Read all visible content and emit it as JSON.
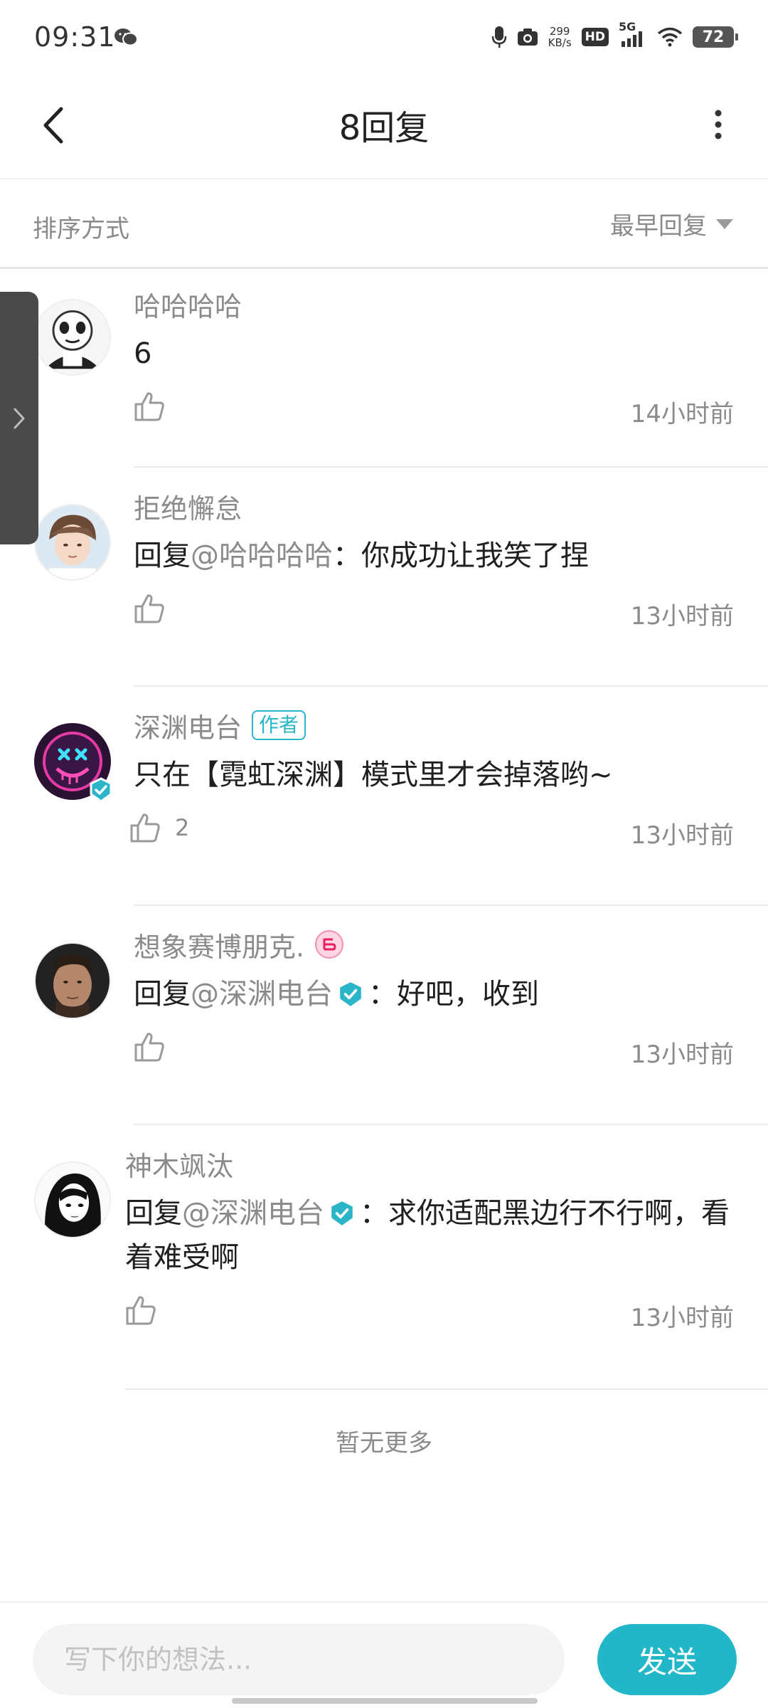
{
  "status_bar": {
    "time": "09:31",
    "net_speed_value": "299",
    "net_speed_unit": "KB/s",
    "hd_label": "HD",
    "network_label": "5G",
    "battery_level": "72"
  },
  "header": {
    "title": "8回复"
  },
  "sort_bar": {
    "label": "排序方式",
    "selected": "最早回复"
  },
  "comments": [
    {
      "name": "哈哈哈哈",
      "text": "6",
      "likes": "",
      "time": "14小时前"
    },
    {
      "name": "拒绝懈怠",
      "reply_prefix": "回复",
      "mention": "@哈哈哈哈",
      "text": "：你成功让我笑了捏",
      "likes": "",
      "time": "13小时前"
    },
    {
      "name": "深渊电台",
      "tag": "作者",
      "text": "只在【霓虹深渊】模式里才会掉落哟~",
      "likes": "2",
      "time": "13小时前"
    },
    {
      "name": "想象赛博朋克.",
      "reply_prefix": "回复",
      "mention": "@深渊电台",
      "text": "：好吧，收到",
      "likes": "",
      "time": "13小时前"
    },
    {
      "name": "神木飒汰",
      "reply_prefix": "回复",
      "mention": "@深渊电台",
      "text": "：求你适配黑边行不行啊，看着难受啊",
      "likes": "",
      "time": "13小时前"
    }
  ],
  "footer_note": "暂无更多",
  "input": {
    "placeholder": "写下你的想法...",
    "value": ""
  },
  "send_label": "发送",
  "colors": {
    "accent": "#22b6c9",
    "verified": "#2bb5c8",
    "secondary_text": "#8b8b8b"
  },
  "icons": [
    "back-icon",
    "more-icon",
    "dropdown-icon",
    "like-icon",
    "verified-icon",
    "side-expand-icon",
    "level-badge-icon"
  ]
}
